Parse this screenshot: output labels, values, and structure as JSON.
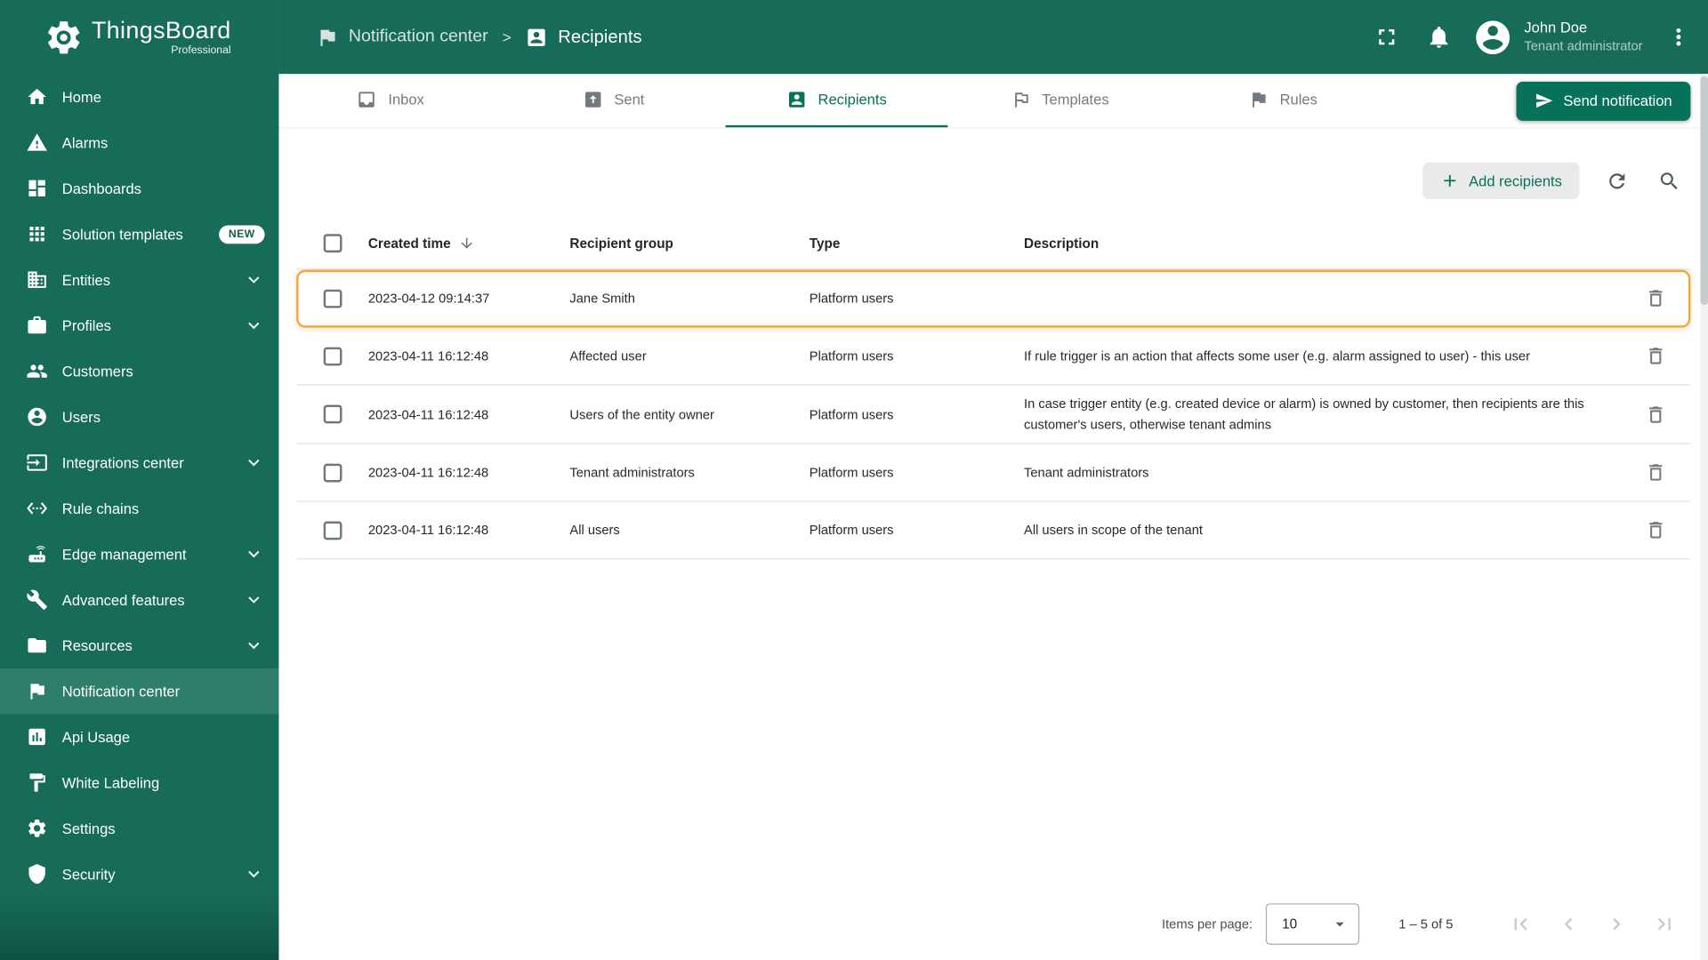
{
  "colors": {
    "primary": "#07715a",
    "sidebar_bg": "#176b59",
    "sidebar_active": "#2d7f6c",
    "row_highlight": "#f2a73d"
  },
  "logo": {
    "title": "ThingsBoard",
    "subtitle": "Professional"
  },
  "header": {
    "breadcrumb": [
      {
        "label": "Notification center",
        "icon": "notification"
      },
      {
        "label": "Recipients",
        "icon": "recipients"
      }
    ],
    "separator": ">",
    "user_name": "John Doe",
    "user_role": "Tenant administrator"
  },
  "sidebar": {
    "items": [
      {
        "label": "Home",
        "icon": "home"
      },
      {
        "label": "Alarms",
        "icon": "alarms"
      },
      {
        "label": "Dashboards",
        "icon": "dashboards"
      },
      {
        "label": "Solution templates",
        "icon": "solution-templates",
        "badge": "NEW"
      },
      {
        "label": "Entities",
        "icon": "entities",
        "expandable": true
      },
      {
        "label": "Profiles",
        "icon": "profiles",
        "expandable": true
      },
      {
        "label": "Customers",
        "icon": "customers"
      },
      {
        "label": "Users",
        "icon": "users"
      },
      {
        "label": "Integrations center",
        "icon": "integrations",
        "expandable": true
      },
      {
        "label": "Rule chains",
        "icon": "rule-chains"
      },
      {
        "label": "Edge management",
        "icon": "edge",
        "expandable": true
      },
      {
        "label": "Advanced features",
        "icon": "advanced",
        "expandable": true
      },
      {
        "label": "Resources",
        "icon": "resources",
        "expandable": true
      },
      {
        "label": "Notification center",
        "icon": "notification",
        "active": true
      },
      {
        "label": "Api Usage",
        "icon": "api-usage"
      },
      {
        "label": "White Labeling",
        "icon": "white-labeling"
      },
      {
        "label": "Settings",
        "icon": "settings"
      },
      {
        "label": "Security",
        "icon": "security",
        "expandable": true
      }
    ]
  },
  "tabs": [
    {
      "label": "Inbox",
      "icon": "inbox"
    },
    {
      "label": "Sent",
      "icon": "sent"
    },
    {
      "label": "Recipients",
      "icon": "recipients",
      "active": true
    },
    {
      "label": "Templates",
      "icon": "templates"
    },
    {
      "label": "Rules",
      "icon": "rules"
    }
  ],
  "actions": {
    "send_notification": "Send notification",
    "add_recipients": "Add recipients"
  },
  "table": {
    "columns": [
      "Created time",
      "Recipient group",
      "Type",
      "Description"
    ],
    "sort": {
      "column": "Created time",
      "direction": "desc"
    },
    "rows": [
      {
        "created_time": "2023-04-12 09:14:37",
        "recipient_group": "Jane Smith",
        "type": "Platform users",
        "description": "",
        "highlighted": true
      },
      {
        "created_time": "2023-04-11 16:12:48",
        "recipient_group": "Affected user",
        "type": "Platform users",
        "description": "If rule trigger is an action that affects some user (e.g. alarm assigned to user) - this user"
      },
      {
        "created_time": "2023-04-11 16:12:48",
        "recipient_group": "Users of the entity owner",
        "type": "Platform users",
        "description": "In case trigger entity (e.g. created device or alarm) is owned by customer, then recipients are this customer's users, otherwise tenant admins"
      },
      {
        "created_time": "2023-04-11 16:12:48",
        "recipient_group": "Tenant administrators",
        "type": "Platform users",
        "description": "Tenant administrators"
      },
      {
        "created_time": "2023-04-11 16:12:48",
        "recipient_group": "All users",
        "type": "Platform users",
        "description": "All users in scope of the tenant"
      }
    ]
  },
  "pagination": {
    "items_per_page_label": "Items per page:",
    "items_per_page": "10",
    "range": "1 – 5 of 5"
  }
}
